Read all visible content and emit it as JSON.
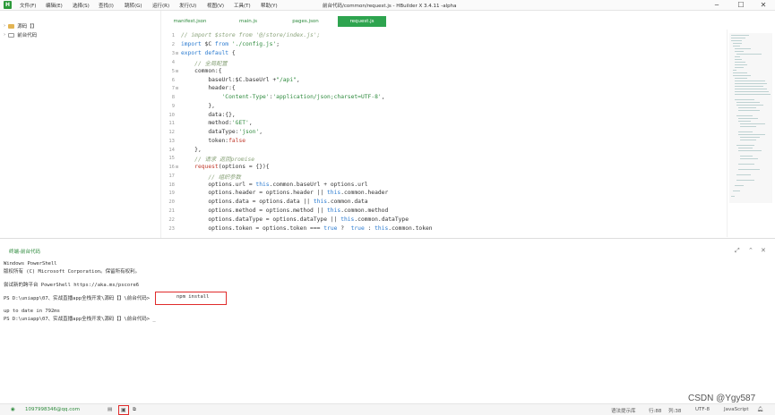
{
  "app": {
    "logo": "H",
    "title": "前台代码/common/request.js - HBuilder X 3.4.11 -alpha"
  },
  "menu": [
    "文件(F)",
    "编辑(E)",
    "选择(S)",
    "查找(I)",
    "跳转(G)",
    "运行(R)",
    "发行(U)",
    "视图(V)",
    "工具(T)",
    "帮助(Y)"
  ],
  "window_controls": {
    "minimize": "─",
    "maximize": "☐",
    "close": "✕"
  },
  "sidebar": {
    "items": [
      {
        "label": "源码【】",
        "icon": "folder-icon"
      },
      {
        "label": "前台代码",
        "icon": "project-icon"
      }
    ]
  },
  "tabs": [
    {
      "label": "manifest.json",
      "active": false
    },
    {
      "label": "main.js",
      "active": false
    },
    {
      "label": "pages.json",
      "active": false
    },
    {
      "label": "request.js",
      "active": true
    }
  ],
  "editor": {
    "line_numbers": [
      "1",
      "2",
      "3",
      "4",
      "5",
      "6",
      "7",
      "8",
      "9",
      "10",
      "11",
      "12",
      "13",
      "14",
      "15",
      "16",
      "17",
      "18",
      "19",
      "20",
      "21",
      "22",
      "23"
    ]
  },
  "terminal": {
    "tab_label": "终端-前台代码",
    "lines": [
      "Windows PowerShell",
      "版权所有 (C) Microsoft Corporation。保留所有权利。",
      "",
      "尝试新的跨平台 PowerShell https://aka.ms/pscore6",
      "",
      "PS D:\\uniapp\\07、实战直播app全栈开发\\源码【】\\前台代码>",
      "",
      "up to date in 792ms",
      "PS D:\\uniapp\\07、实战直播app全栈开发\\源码【】\\前台代码> _"
    ],
    "command": "npm install"
  },
  "statusbar": {
    "email": "1097998346@qq.com",
    "hint": "语法提示库",
    "line": "行:88",
    "col": "列:38",
    "encoding": "UTF-8",
    "language": "JavaScript"
  },
  "watermark": "CSDN @Ygy587",
  "colors": {
    "accent": "#2ea44f",
    "highlight": "#e02b2b"
  }
}
